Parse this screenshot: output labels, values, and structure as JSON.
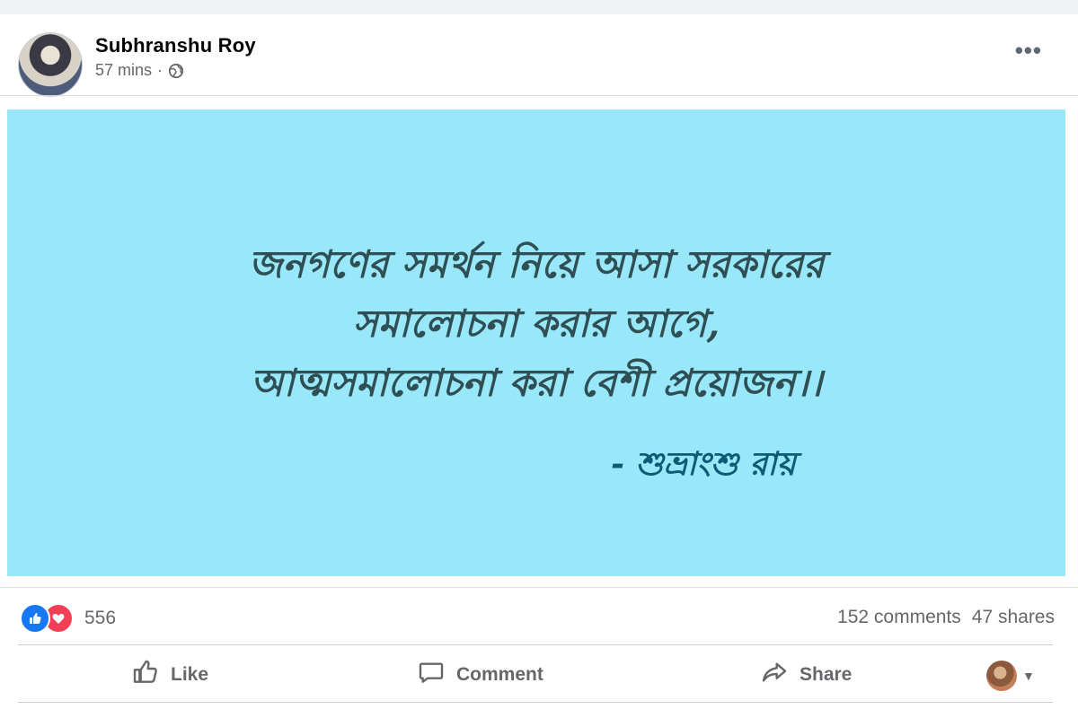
{
  "post": {
    "author": "Subhranshu Roy",
    "time": "57 mins",
    "separator": "·",
    "privacy_icon": "globe-icon",
    "menu_icon": "more-options-icon",
    "menu_label": "•••"
  },
  "image": {
    "background": "#99e8f9",
    "quote_lines": [
      "জনগণের সমর্থন নিয়ে আসা সরকারের",
      "সমালোচনা করার আগে,",
      "আত্মসমালোচনা করা বেশী প্রয়োজন।।"
    ],
    "signature": "- শুভ্রাংশু রায়"
  },
  "stats": {
    "reaction_icons": [
      "like-reaction-icon",
      "love-reaction-icon"
    ],
    "reaction_count": "556",
    "comments": "152 comments",
    "shares": "47 shares"
  },
  "actions": {
    "like_label": "Like",
    "comment_label": "Comment",
    "share_label": "Share"
  },
  "colors": {
    "like_blue": "#1877f2",
    "love_red": "#f33e58",
    "secondary_text": "#65676b"
  }
}
